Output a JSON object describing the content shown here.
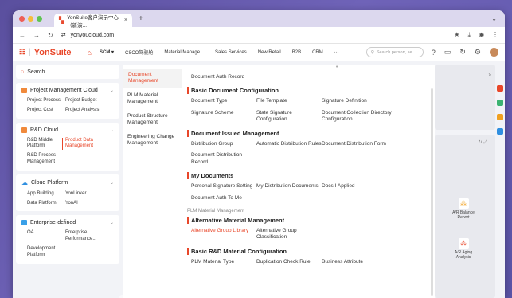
{
  "browser": {
    "tab_title": "YonSuite客户演示中心（新演...",
    "tab_close": "×",
    "new_tab": "+",
    "url": "yonyoucloud.com"
  },
  "header": {
    "brand": "YonSuite",
    "nav": [
      "SCM ▾",
      "CSCO驾驶舱",
      "Material Manage...",
      "Sales Services",
      "New Retail",
      "B2B",
      "CRM",
      "···"
    ],
    "search_placeholder": "Search person, se..."
  },
  "left": {
    "search": "Search",
    "cards": [
      {
        "title": "Project Management Cloud",
        "color": "#f08a3c",
        "items": [
          "Project Process",
          "Project Budget",
          "Project Cost",
          "Project Analysis"
        ]
      },
      {
        "title": "R&D Cloud",
        "color": "#f08a3c",
        "items": [
          "R&D Middle Platform",
          "Product Data Management",
          "R&D Process Management"
        ]
      },
      {
        "title": "Cloud Platform",
        "color": "#2f8fe0",
        "items": [
          "App Building",
          "YonLinker",
          "Data Platform",
          "YonAI"
        ]
      },
      {
        "title": "Enterprise-defined",
        "color": "#3aa0e8",
        "items": [
          "OA",
          "Enterprise Performance...",
          "Development Platform"
        ]
      }
    ]
  },
  "mid": {
    "items": [
      "Document Management",
      "PLM Material Management",
      "Product Structure Management",
      "Engineering Change Management"
    ]
  },
  "content": {
    "top_fragment": "Ŧ",
    "auth_record": "Document Auth Record",
    "s1_title": "Basic Document Configuration",
    "s1_items": [
      "Document Type",
      "File Template",
      "Signature Definition",
      "Signature Scheme",
      "State Signature Configuration",
      "Document Collection Directory Configuration"
    ],
    "s2_title": "Document Issued Management",
    "s2_items": [
      "Distribution Group",
      "Automatic Distribution Rules",
      "Document Distribution Form",
      "Document Distribution Record"
    ],
    "s3_title": "My Documents",
    "s3_items": [
      "Personal Signature Setting",
      "My Distribution Documents",
      "Docs I Applied",
      "Document Auth To Me"
    ],
    "sub_label": "PLM Material Management",
    "s4_title": "Alternative Material Management",
    "s4_items": [
      "Alternative Group Library",
      "Alternative Group Classification"
    ],
    "s5_title": "Basic R&D Material Configuration",
    "s5_items": [
      "PLM Material Type",
      "Duplication Check Rule",
      "Business Attribute"
    ]
  },
  "right": {
    "node1": "A/R Balance Report",
    "node2": "A/R Aging Analysis"
  }
}
